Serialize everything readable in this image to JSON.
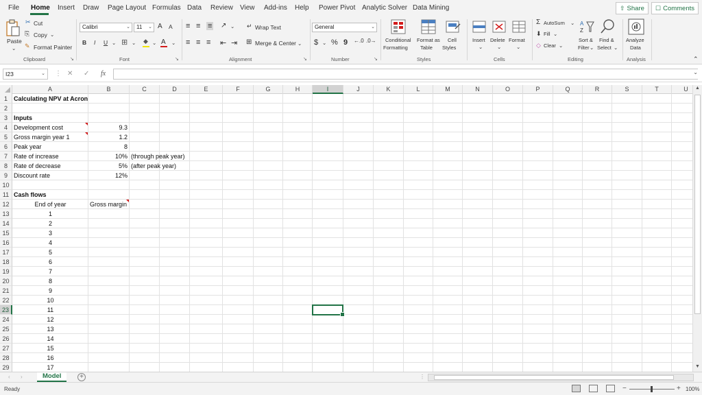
{
  "menu": {
    "tabs": [
      "File",
      "Home",
      "Insert",
      "Draw",
      "Page Layout",
      "Formulas",
      "Data",
      "Review",
      "View",
      "Add-ins",
      "Help",
      "Power Pivot",
      "Analytic Solver",
      "Data Mining"
    ],
    "share_label": "Share",
    "comments_label": "Comments"
  },
  "ribbon": {
    "clipboard": {
      "paste": "Paste",
      "cut": "Cut",
      "copy": "Copy",
      "format_painter": "Format Painter",
      "label": "Clipboard"
    },
    "font": {
      "name": "Calibri",
      "size": "11",
      "bold": "B",
      "italic": "I",
      "underline": "U",
      "grow": "A",
      "shrink": "A",
      "label": "Font"
    },
    "alignment": {
      "wrap_text": "Wrap Text",
      "merge_center": "Merge & Center",
      "label": "Alignment"
    },
    "number": {
      "format": "General",
      "currency": "$",
      "percent": "%",
      "comma": "9",
      "label": "Number"
    },
    "styles": {
      "conditional": "Conditional",
      "conditional2": "Formatting",
      "format_as": "Format as",
      "format_as2": "Table",
      "cell": "Cell",
      "cell2": "Styles",
      "label": "Styles"
    },
    "cells": {
      "insert": "Insert",
      "delete": "Delete",
      "format": "Format",
      "label": "Cells"
    },
    "editing": {
      "autosum": "AutoSum",
      "fill": "Fill",
      "clear": "Clear",
      "sort": "Sort &",
      "sort2": "Filter",
      "find": "Find &",
      "find2": "Select",
      "label": "Editing"
    },
    "analysis": {
      "analyze": "Analyze",
      "analyze2": "Data",
      "label": "Analysis"
    }
  },
  "formula_bar": {
    "name_box": "I23",
    "fx": "fx",
    "content": ""
  },
  "columns": [
    "A",
    "B",
    "C",
    "D",
    "E",
    "F",
    "G",
    "H",
    "I",
    "J",
    "K",
    "L",
    "M",
    "N",
    "O",
    "P",
    "Q",
    "R",
    "S",
    "T",
    "U"
  ],
  "rows": [
    "1",
    "2",
    "3",
    "4",
    "5",
    "6",
    "7",
    "8",
    "9",
    "10",
    "11",
    "12",
    "13",
    "14",
    "15",
    "16",
    "17",
    "18",
    "19",
    "20",
    "21",
    "22",
    "23",
    "24",
    "25",
    "26",
    "27",
    "28",
    "29"
  ],
  "selected_column": "I",
  "selected_row": "23",
  "cells": {
    "A1": "Calculating NPV at Acron",
    "A3": "Inputs",
    "A4": "Development cost",
    "B4": "9.3",
    "A5": "Gross margin year 1",
    "B5": "1.2",
    "A6": "Peak year",
    "B6": "8",
    "A7": "Rate of increase",
    "B7": "10%",
    "C7": "(through peak year)",
    "A8": "Rate of decrease",
    "B8": "5%",
    "C8": "(after peak year)",
    "A9": "Discount rate",
    "B9": "12%",
    "A11": "Cash flows",
    "A12": "End of year",
    "B12": "Gross margin",
    "A13": "1",
    "A14": "2",
    "A15": "3",
    "A16": "4",
    "A17": "5",
    "A18": "6",
    "A19": "7",
    "A20": "8",
    "A21": "9",
    "A22": "10",
    "A23": "11",
    "A24": "12",
    "A25": "13",
    "A26": "14",
    "A27": "15",
    "A28": "16",
    "A29": "17"
  },
  "sheet_tab": "Model",
  "status": {
    "text": "Ready",
    "zoom": "100%"
  },
  "colors": {
    "accent": "#217346",
    "comment_marker": "#d21b1b"
  }
}
